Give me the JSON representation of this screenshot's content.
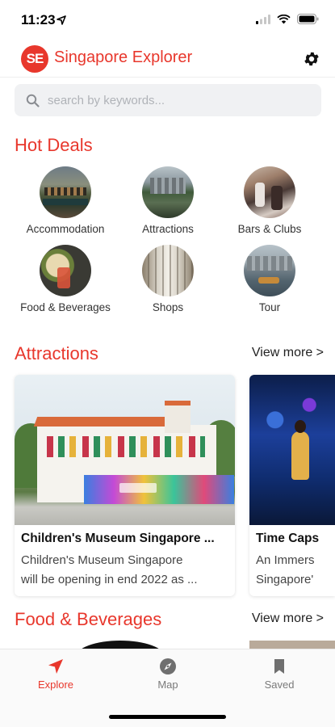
{
  "status": {
    "time": "11:23"
  },
  "header": {
    "logo": "SE",
    "title": "Singapore Explorer"
  },
  "search": {
    "placeholder": "search by keywords..."
  },
  "hot_deals": {
    "title": "Hot Deals",
    "categories": [
      {
        "label": "Accommodation"
      },
      {
        "label": "Attractions"
      },
      {
        "label": "Bars & Clubs"
      },
      {
        "label": "Food & Beverages"
      },
      {
        "label": "Shops"
      },
      {
        "label": "Tour"
      }
    ]
  },
  "attractions": {
    "title": "Attractions",
    "view_more": "View more >",
    "cards": [
      {
        "title": "Children's Museum Singapore ...",
        "desc_line1": "Children's Museum Singapore",
        "desc_line2": "will be opening in end 2022 as ..."
      },
      {
        "title": "Time Caps",
        "desc_line1": "An Immers",
        "desc_line2": "Singapore'"
      }
    ]
  },
  "food": {
    "title": "Food & Beverages",
    "view_more": "View more >"
  },
  "tabs": [
    {
      "label": "Explore",
      "active": true
    },
    {
      "label": "Map",
      "active": false
    },
    {
      "label": "Saved",
      "active": false
    }
  ],
  "colors": {
    "accent": "#e8372c",
    "inactive": "#7a7a7a"
  },
  "icons": [
    "location-arrow-icon",
    "signal-icon",
    "wifi-icon",
    "battery-icon",
    "gear-icon",
    "search-icon",
    "navigation-icon",
    "compass-icon",
    "bookmark-icon"
  ]
}
